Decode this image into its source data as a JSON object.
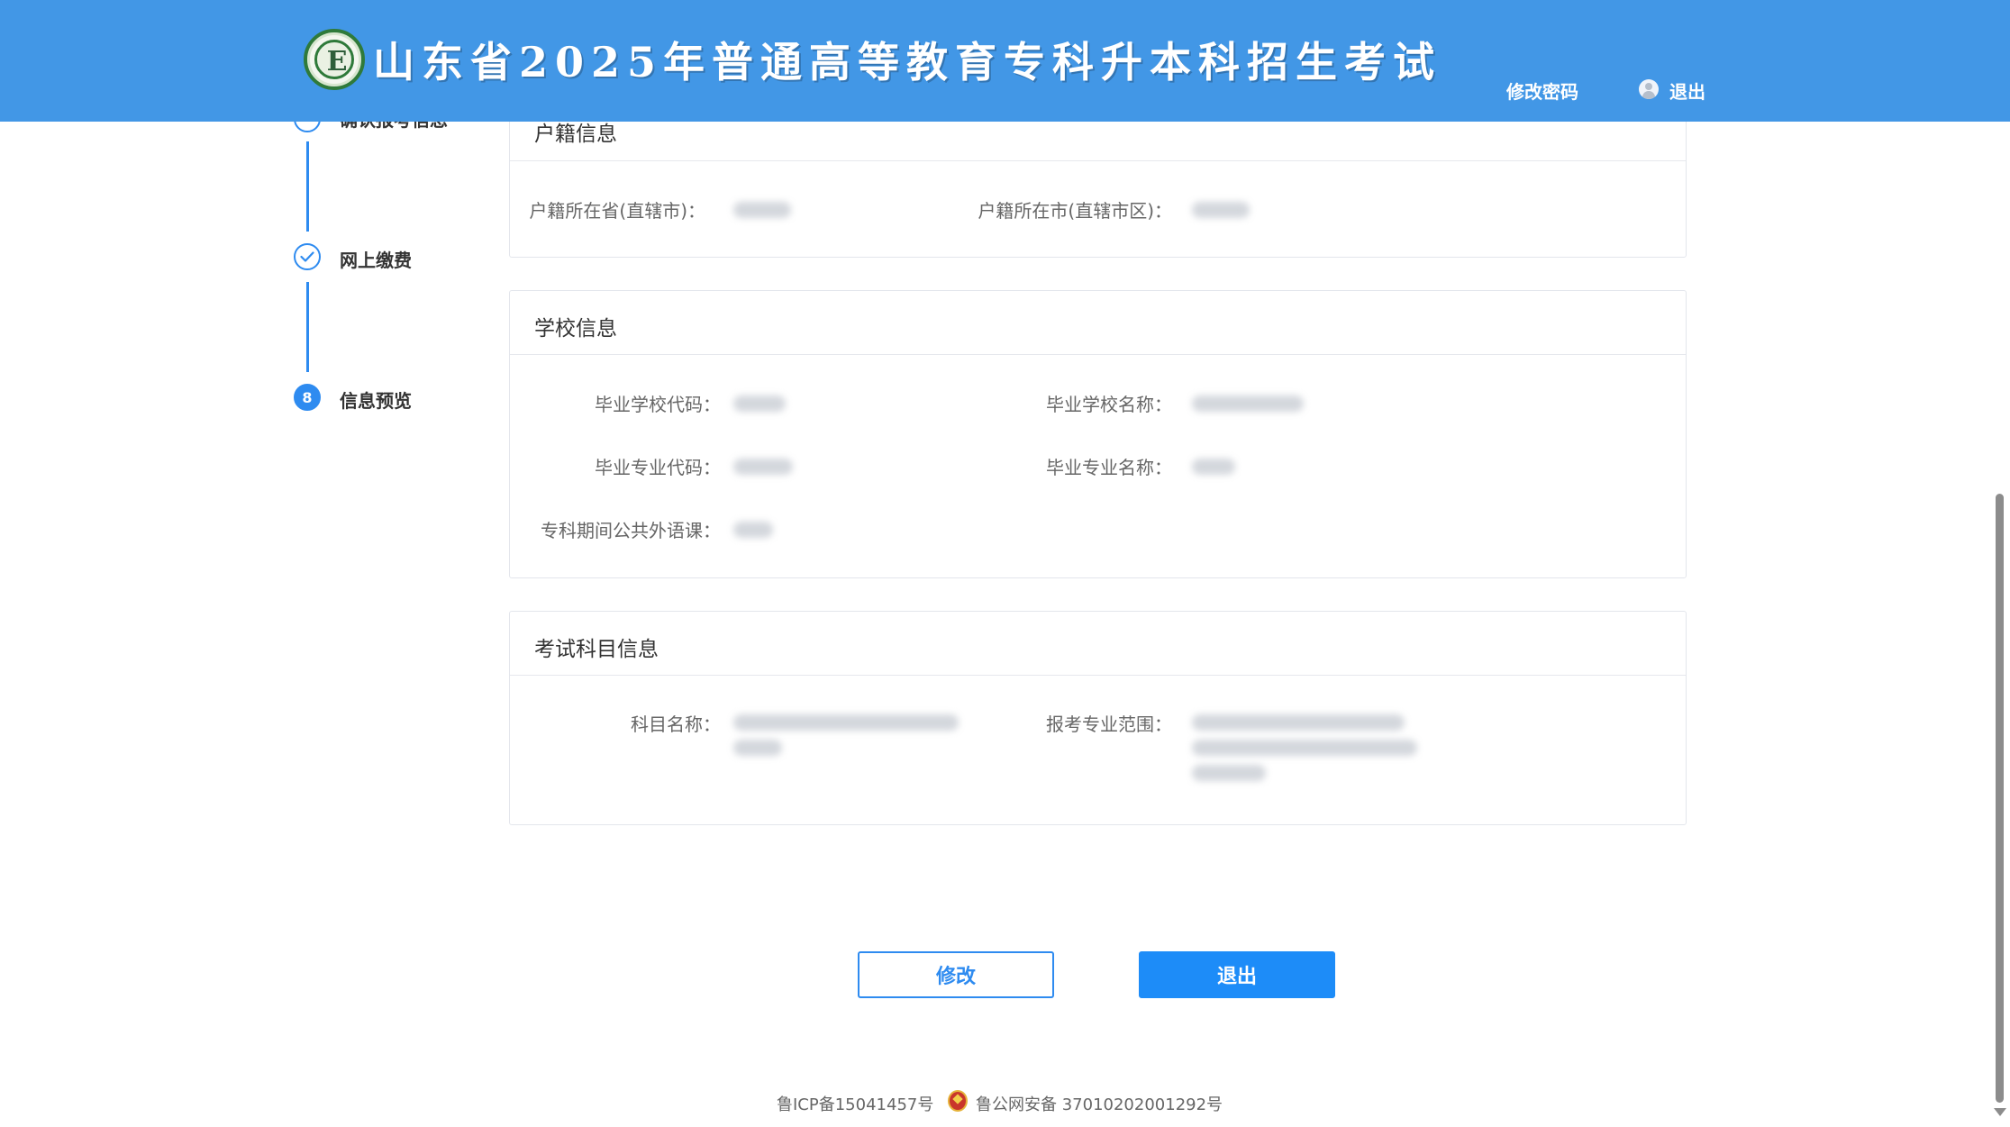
{
  "header": {
    "logo_letter": "E",
    "title": "山东省2025年普通高等教育专科升本科招生考试",
    "change_password": "修改密码",
    "logout": "退出",
    "bg_color": "#4297e6"
  },
  "stepper": {
    "accent_color": "#2e8bf0",
    "steps": [
      {
        "label": "确认报考信息",
        "status": "done"
      },
      {
        "label": "网上缴费",
        "status": "done"
      },
      {
        "label": "信息预览",
        "number": "8",
        "status": "current"
      }
    ]
  },
  "household": {
    "title": "户籍信息",
    "province_label": "户籍所在省(直辖市)：",
    "city_label": "户籍所在市(直辖市区)："
  },
  "school": {
    "title": "学校信息",
    "school_code_label": "毕业学校代码：",
    "school_name_label": "毕业学校名称：",
    "major_code_label": "毕业专业代码：",
    "major_name_label": "毕业专业名称：",
    "foreign_lang_label": "专科期间公共外语课："
  },
  "exam": {
    "title": "考试科目信息",
    "subject_label": "科目名称：",
    "scope_label": "报考专业范围："
  },
  "actions": {
    "edit": "修改",
    "exit": "退出"
  },
  "footer": {
    "icp": "鲁ICP备15041457号",
    "police": "鲁公网安备 37010202001292号"
  }
}
